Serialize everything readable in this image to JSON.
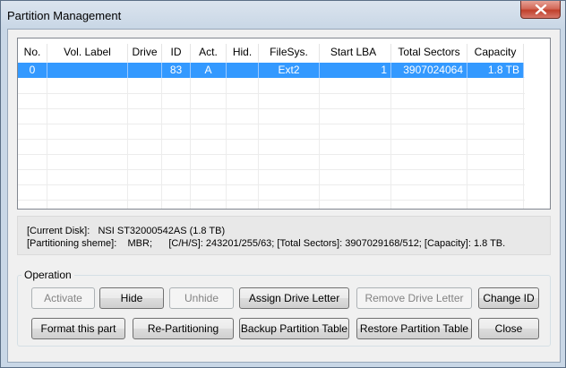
{
  "window": {
    "title": "Partition Management"
  },
  "table": {
    "columns": [
      "No.",
      "Vol. Label",
      "Drive",
      "ID",
      "Act.",
      "Hid.",
      "FileSys.",
      "Start LBA",
      "Total Sectors",
      "Capacity"
    ],
    "rows": [
      [
        "0",
        "",
        "",
        "83",
        "A",
        "",
        "Ext2",
        "1",
        "3907024064",
        "1.8 TB"
      ]
    ]
  },
  "info": {
    "line1": "[Current Disk]:   NSI ST32000542AS (1.8 TB)",
    "line2": "[Partitioning sheme]:    MBR;      [C/H/S]: 243201/255/63; [Total Sectors]: 3907029168/512; [Capacity]: 1.8 TB."
  },
  "operation": {
    "label": "Operation",
    "buttons": {
      "activate": "Activate",
      "hide": "Hide",
      "unhide": "Unhide",
      "assign": "Assign Drive Letter",
      "remove": "Remove Drive Letter",
      "change_id": "Change ID",
      "format": "Format this part",
      "repartition": "Re-Partitioning",
      "backup": "Backup Partition Table",
      "restore": "Restore Partition Table",
      "close": "Close"
    }
  }
}
